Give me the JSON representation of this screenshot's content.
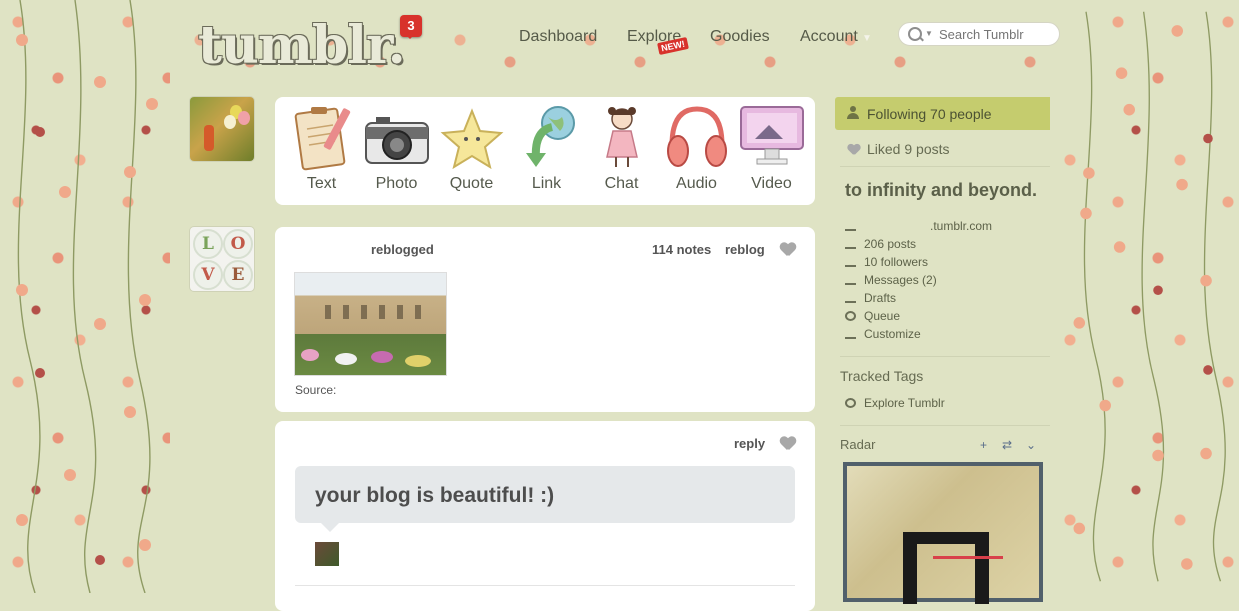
{
  "header": {
    "logo_text": "tumblr.",
    "notification_count": "3",
    "nav": {
      "dashboard": "Dashboard",
      "explore": "Explore",
      "explore_badge": "NEW!",
      "goodies": "Goodies",
      "account": "Account"
    },
    "search_placeholder": "Search Tumblr"
  },
  "composer": {
    "post_types": [
      "Text",
      "Photo",
      "Quote",
      "Link",
      "Chat",
      "Audio",
      "Video"
    ]
  },
  "avatar_love_letters": [
    "L",
    "O",
    "V",
    "E"
  ],
  "post_photo": {
    "action": "reblogged",
    "notes": "114 notes",
    "reblog_label": "reblog",
    "source_label": "Source:"
  },
  "post_answer": {
    "reply_label": "reply",
    "message": "your blog is beautiful! :)"
  },
  "sidebar": {
    "following": "Following 70 people",
    "liked": "Liked 9 posts",
    "blog_title": "to infinity and beyond.",
    "blog_url": ".tumblr.com",
    "links": {
      "posts": "206 posts",
      "followers": "10 followers",
      "messages": "Messages (2)",
      "drafts": "Drafts",
      "queue": "Queue",
      "customize": "Customize"
    },
    "tracked_tags_title": "Tracked Tags",
    "explore_tumblr": "Explore Tumblr",
    "radar_title": "Radar"
  },
  "colors": {
    "page_bg": "#dfe3c4",
    "following_highlight": "#c5cc6e",
    "badge_red": "#d8322b",
    "radar_border": "#51606b"
  },
  "icons": [
    "search-icon",
    "heart-icon",
    "user-icon",
    "reply-icon"
  ]
}
